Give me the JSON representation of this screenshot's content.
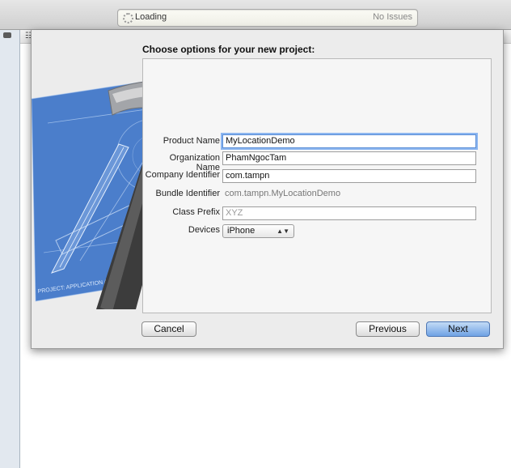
{
  "toolbar": {
    "activity_status": "Loading",
    "issues": "No Issues"
  },
  "sheet": {
    "title": "Choose options for your new project:"
  },
  "form": {
    "product_name": {
      "label": "Product Name",
      "value": "MyLocationDemo"
    },
    "organization_name": {
      "label": "Organization Name",
      "value": "PhamNgocTam"
    },
    "company_identifier": {
      "label": "Company Identifier",
      "value": "com.tampn"
    },
    "bundle_identifier": {
      "label": "Bundle Identifier",
      "value": "com.tampn.MyLocationDemo"
    },
    "class_prefix": {
      "label": "Class Prefix",
      "placeholder": "XYZ"
    },
    "devices": {
      "label": "Devices",
      "value": "iPhone"
    }
  },
  "blueprint": {
    "caption": "PROJECT: APPLICATION APP"
  },
  "buttons": {
    "cancel": "Cancel",
    "previous": "Previous",
    "next": "Next"
  },
  "colors": {
    "accent": "#6fa2e4",
    "blueprint": "#3d74c8"
  }
}
